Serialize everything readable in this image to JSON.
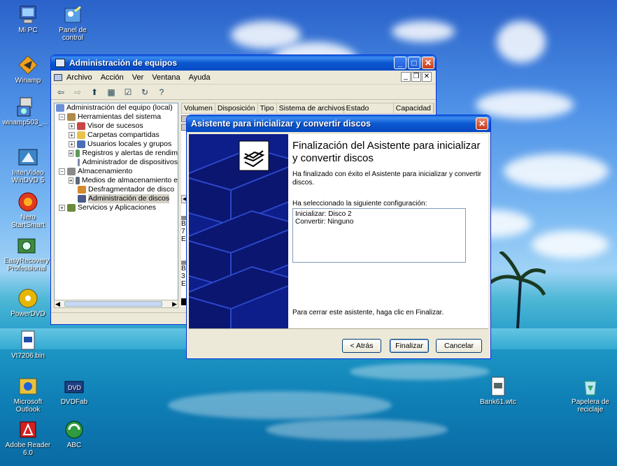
{
  "desktop_icons": [
    {
      "label": "Mi PC",
      "icon": "my-computer-icon"
    },
    {
      "label": "Panel de\ncontrol",
      "icon": "control-panel-icon"
    },
    {
      "label": "Winamp",
      "icon": "winamp-icon"
    },
    {
      "label": "winamp503_...",
      "icon": "installer-icon"
    },
    {
      "label": "InterVideo\nWinDVD 5",
      "icon": "windvd-icon"
    },
    {
      "label": "Nero\nStartSmart",
      "icon": "nero-icon"
    },
    {
      "label": "EasyRecovery\nProfessional",
      "icon": "easyrecovery-icon"
    },
    {
      "label": "PowerDVD",
      "icon": "powerdvd-icon"
    },
    {
      "label": "Vt7206.bin",
      "icon": "bin-file-icon"
    },
    {
      "label": "Microsoft\nOutlook",
      "icon": "outlook-icon"
    },
    {
      "label": "DVDFab",
      "icon": "dvdfab-icon"
    },
    {
      "label": "Adobe Reader\n6.0",
      "icon": "adobe-reader-icon"
    },
    {
      "label": "ABC",
      "icon": "abc-icon"
    },
    {
      "label": "Bank61.wtc",
      "icon": "wtc-file-icon"
    },
    {
      "label": "Papelera de\nreciclaje",
      "icon": "recycle-bin-icon"
    }
  ],
  "mgmt": {
    "title": "Administración de equipos",
    "menu": [
      "Archivo",
      "Acción",
      "Ver",
      "Ventana",
      "Ayuda"
    ],
    "tree": [
      {
        "label": "Administración del equipo (local)",
        "level": 0,
        "toggle": ""
      },
      {
        "label": "Herramientas del sistema",
        "level": 1,
        "toggle": "−"
      },
      {
        "label": "Visor de sucesos",
        "level": 2,
        "toggle": "+"
      },
      {
        "label": "Carpetas compartidas",
        "level": 2,
        "toggle": "+"
      },
      {
        "label": "Usuarios locales y grupos",
        "level": 2,
        "toggle": "+"
      },
      {
        "label": "Registros y alertas de rendim",
        "level": 2,
        "toggle": "+"
      },
      {
        "label": "Administrador de dispositivos",
        "level": 2,
        "toggle": ""
      },
      {
        "label": "Almacenamiento",
        "level": 1,
        "toggle": "−"
      },
      {
        "label": "Medios de almacenamiento e",
        "level": 2,
        "toggle": "+"
      },
      {
        "label": "Desfragmentador de disco",
        "level": 2,
        "toggle": ""
      },
      {
        "label": "Administración de discos",
        "level": 2,
        "toggle": "",
        "selected": true
      },
      {
        "label": "Servicios y Aplicaciones",
        "level": 1,
        "toggle": "+"
      }
    ],
    "columns": [
      "Volumen",
      "Disposición",
      "Tipo",
      "Sistema de archivos",
      "Estado",
      "Capacidad"
    ],
    "disk_fragments": [
      {
        "lines": [
          "B",
          "7",
          "E"
        ]
      },
      {
        "lines": [
          "B",
          "3",
          "E"
        ]
      }
    ]
  },
  "wizard": {
    "title": "Asistente para inicializar y convertir discos",
    "heading": "Finalización del Asistente para inicializar y convertir discos",
    "intro": "Ha finalizado con éxito el Asistente para inicializar y convertir discos.",
    "config_label": "Ha seleccionado la siguiente configuración:",
    "config_lines": [
      "Inicializar: Disco 2",
      "Convertir: Ninguno"
    ],
    "closing_text": "Para cerrar este asistente, haga clic en Finalizar.",
    "back_button": "< Atrás",
    "finish_button": "Finalizar",
    "cancel_button": "Cancelar"
  }
}
